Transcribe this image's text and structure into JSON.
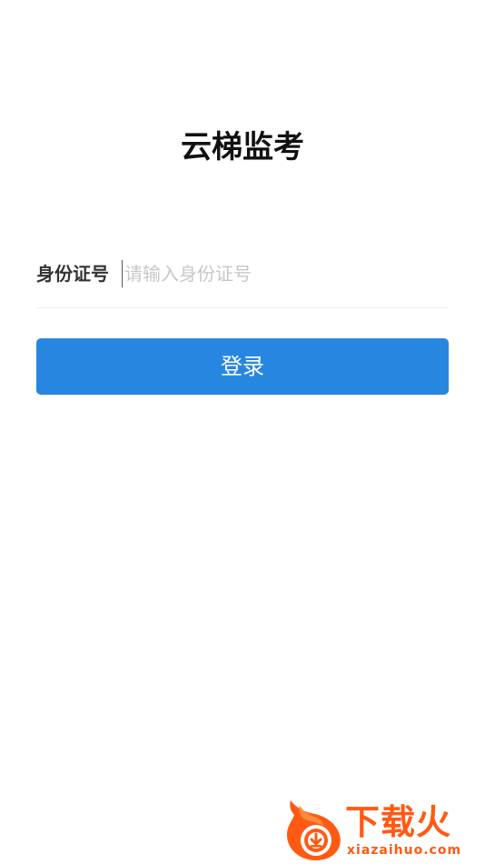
{
  "app": {
    "title": "云梯监考"
  },
  "login_form": {
    "id_label": "身份证号",
    "id_placeholder": "请输入身份证号",
    "id_value": "",
    "login_button_label": "登录"
  },
  "watermark": {
    "brand": "下载火",
    "domain": "xiazaihuo.com",
    "icon": "flame-download-icon"
  },
  "colors": {
    "primary_button": "#2787e0",
    "watermark": "#ff5a14",
    "placeholder": "#c8c8c8"
  }
}
